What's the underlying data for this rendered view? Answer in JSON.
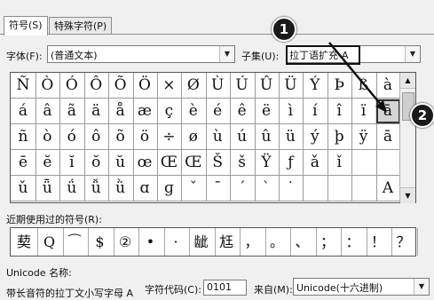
{
  "tabs": {
    "symbols": "符号(S)",
    "special": "特殊字符(P)"
  },
  "font": {
    "label": "字体(F):",
    "value": "(普通文本)"
  },
  "subset": {
    "label": "子集(U):",
    "value": "拉丁语扩充-A"
  },
  "grid": [
    [
      "Ñ",
      "Ò",
      "Ó",
      "Ô",
      "Õ",
      "Ö",
      "×",
      "Ø",
      "Ù",
      "Ú",
      "Û",
      "Ü",
      "Ý",
      "Þ",
      "ß",
      "à"
    ],
    [
      "á",
      "â",
      "ã",
      "ä",
      "å",
      "æ",
      "ç",
      "è",
      "é",
      "ê",
      "ë",
      "ì",
      "í",
      "î",
      "ï",
      "ā"
    ],
    [
      "ñ",
      "ò",
      "ó",
      "ô",
      "õ",
      "ö",
      "÷",
      "ø",
      "ù",
      "ú",
      "û",
      "ü",
      "ý",
      "þ",
      "ÿ",
      "ā"
    ],
    [
      "ē",
      "ĕ",
      "ĭ",
      "ŏ",
      "ŭ",
      "œ",
      "Œ",
      "Œ",
      "Š",
      "š",
      "Ÿ",
      "ƒ",
      "ǎ",
      "ǐ",
      "",
      ""
    ],
    [
      "ǔ",
      "ǖ",
      "ǘ",
      "ǚ",
      "ǜ",
      "ɑ",
      "ɡ",
      "ˇ",
      "ˉ",
      "ˊ",
      "ˋ",
      "˙",
      "",
      "",
      "",
      "A"
    ]
  ],
  "recent_label": "近期使用过的符号(R):",
  "recent": [
    "葜",
    "Q",
    "⁀",
    "$",
    "②",
    "•",
    "·",
    "龇",
    "尪",
    "，",
    "。",
    "、",
    "；",
    "：",
    "！",
    "？"
  ],
  "unicode_name_label": "Unicode 名称:",
  "unicode_name_value": "带长音符的拉丁文小写字母 A",
  "char_code_label": "字符代码(C):",
  "char_code_value": "0101",
  "from_label": "来自(M):",
  "from_value": "Unicode(十六进制)",
  "callouts": [
    "1",
    "2"
  ]
}
